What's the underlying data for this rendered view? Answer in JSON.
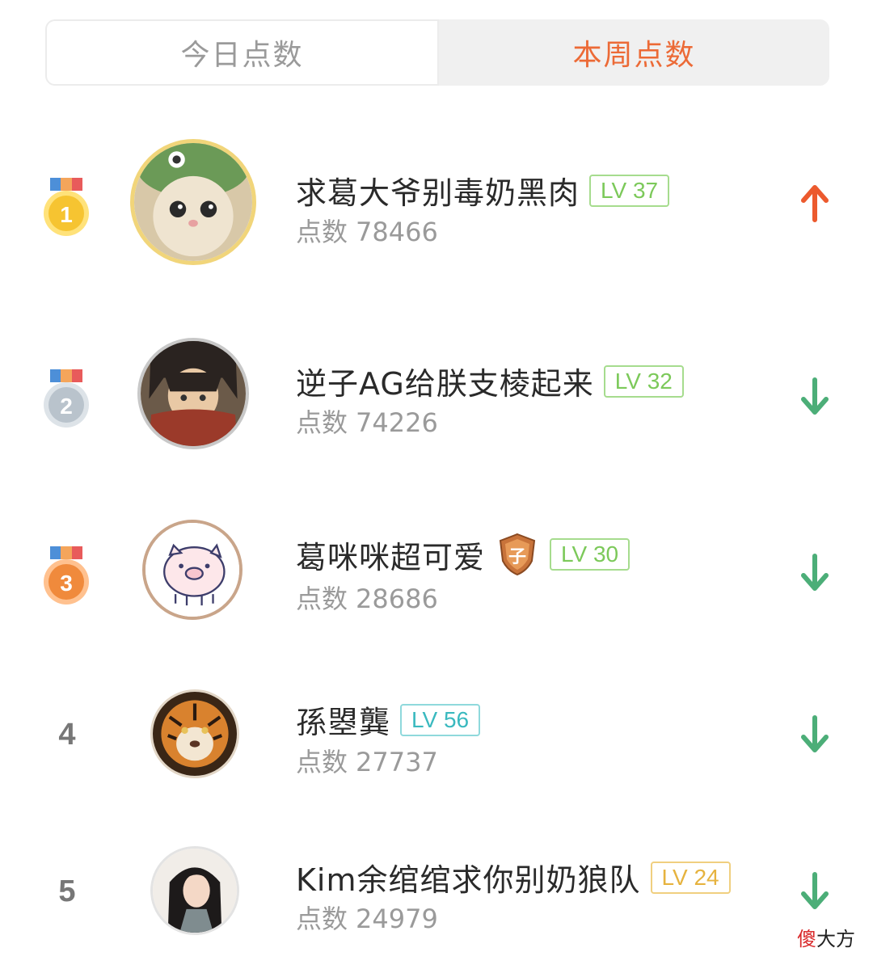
{
  "tabs": {
    "today": "今日点数",
    "week": "本周点数"
  },
  "points_label": "点数",
  "ranking": [
    {
      "rank": "1",
      "name": "求葛大爷别毒奶黑肉",
      "level": "LV 37",
      "points": "78466",
      "trend": "up"
    },
    {
      "rank": "2",
      "name": "逆子AG给朕支棱起来",
      "level": "LV 32",
      "points": "74226",
      "trend": "down"
    },
    {
      "rank": "3",
      "name": "葛咪咪超可爱",
      "badge": "子",
      "level": "LV 30",
      "points": "28686",
      "trend": "down"
    },
    {
      "rank": "4",
      "name": "孫曌龔",
      "level": "LV 56",
      "points": "27737",
      "trend": "down"
    },
    {
      "rank": "5",
      "name": "Kim余绾绾求你别奶狼队",
      "level": "LV 24",
      "points": "24979",
      "trend": "down"
    }
  ],
  "watermark": {
    "red": "傻",
    "black": "大方"
  },
  "colors": {
    "accent": "#ec6a36",
    "trend_up": "#ec5a2e",
    "trend_down": "#4cae78",
    "level_green": "#7cc95a",
    "level_teal": "#3ab9bf",
    "level_gold": "#e6b33f",
    "medal_gold": "#f6c431",
    "medal_silver": "#b9c3cc",
    "medal_bronze": "#f08a3c"
  }
}
